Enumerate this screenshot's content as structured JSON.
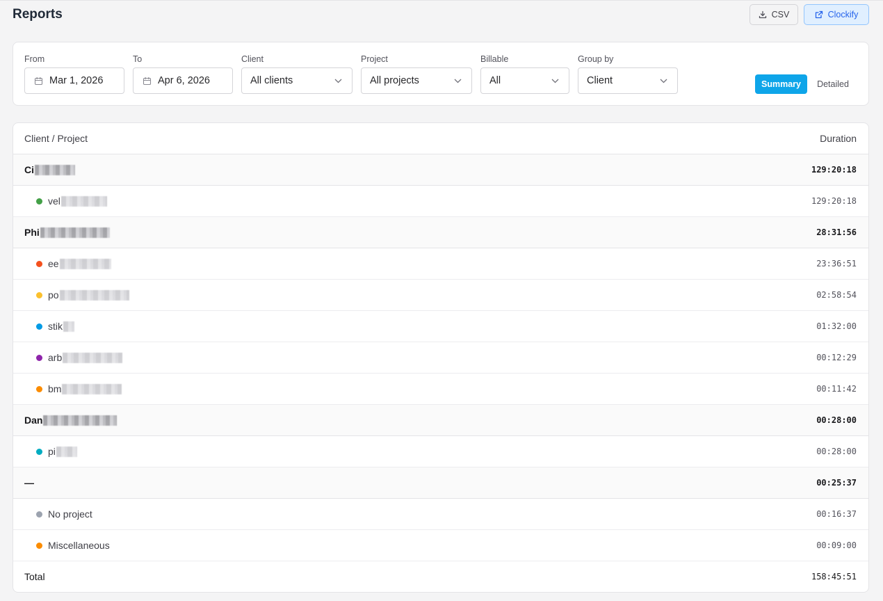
{
  "page": {
    "title": "Reports"
  },
  "header_actions": {
    "csv_label": "CSV",
    "clockify_label": "Clockify"
  },
  "filters": {
    "from": {
      "label": "From",
      "value": "Mar 1, 2026"
    },
    "to": {
      "label": "To",
      "value": "Apr 6, 2026"
    },
    "client": {
      "label": "Client",
      "value": "All clients"
    },
    "project": {
      "label": "Project",
      "value": "All projects"
    },
    "billable": {
      "label": "Billable",
      "value": "All"
    },
    "group_by": {
      "label": "Group by",
      "value": "Client"
    },
    "view_toggle": {
      "summary_label": "Summary",
      "detailed_label": "Detailed",
      "active": "Summary"
    }
  },
  "table": {
    "headers": {
      "name": "Client / Project",
      "duration": "Duration"
    },
    "groups": [
      {
        "client": "Ci",
        "duration": "129:20:18",
        "projects": [
          {
            "name": "vel",
            "color": "#43a047",
            "duration": "129:20:18"
          }
        ]
      },
      {
        "client": "Phi",
        "duration": "28:31:56",
        "projects": [
          {
            "name": "ee",
            "color": "#f4511e",
            "duration": "23:36:51"
          },
          {
            "name": "po",
            "color": "#fbc02d",
            "duration": "02:58:54"
          },
          {
            "name": "stik",
            "color": "#039be5",
            "duration": "01:32:00"
          },
          {
            "name": "arb",
            "color": "#8e24aa",
            "duration": "00:12:29"
          },
          {
            "name": "bm",
            "color": "#fb8c00",
            "duration": "00:11:42"
          }
        ]
      },
      {
        "client": "Dan",
        "duration": "00:28:00",
        "projects": [
          {
            "name": "pi",
            "color": "#00acc1",
            "duration": "00:28:00"
          }
        ]
      },
      {
        "client": "—",
        "duration": "00:25:37",
        "projects": [
          {
            "name": "No project",
            "color": "#9ca3af",
            "duration": "00:16:37"
          },
          {
            "name": "Miscellaneous",
            "color": "#fb8c00",
            "duration": "00:09:00"
          }
        ]
      }
    ],
    "total": {
      "label": "Total",
      "duration": "158:45:51"
    }
  },
  "colors": {
    "accent": "#0ea5e9",
    "link": "#2563eb"
  }
}
